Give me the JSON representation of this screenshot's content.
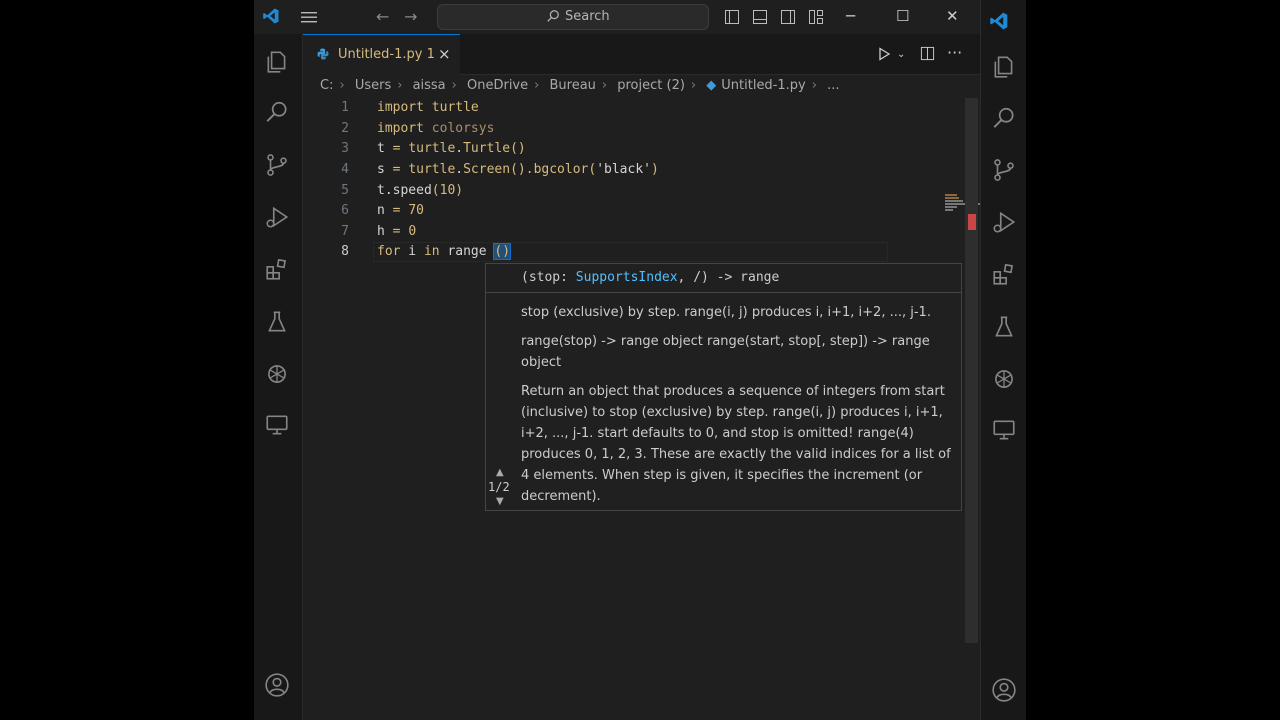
{
  "app": {
    "accent": "#0078d4",
    "logo_icon": "vscode-logo-icon"
  },
  "titlebar": {
    "search_placeholder": "Search"
  },
  "tab": {
    "label": "Untitled-1.py 1",
    "close": "×"
  },
  "breadcrumb": [
    "C:",
    "Users",
    "aissa",
    "OneDrive",
    "Bureau",
    "project (2)",
    "Untitled-1.py",
    "..."
  ],
  "editor": {
    "line_numbers": [
      "1",
      "2",
      "3",
      "4",
      "5",
      "6",
      "7",
      "8"
    ],
    "lines": {
      "l1_kw": "import",
      "l1_mod": "turtle",
      "l2_kw": "import",
      "l2_mod": "colorsys",
      "l3_a": "t",
      "l3_b": " = ",
      "l3_c": "turtle",
      "l3_d": ".",
      "l3_e": "Turtle",
      "l3_f": "()",
      "l4_a": "s",
      "l4_b": " = ",
      "l4_c": "turtle",
      "l4_d": ".",
      "l4_e": "Screen",
      "l4_f": "().",
      "l4_g": "bgcolor",
      "l4_h": "(",
      "l4_i": "'black'",
      "l4_j": ")",
      "l5_a": "t",
      "l5_b": ".",
      "l5_c": "speed",
      "l5_d": "(",
      "l5_e": "10",
      "l5_f": ")",
      "l6_a": "n",
      "l6_b": " = ",
      "l6_c": "70",
      "l7_a": "h",
      "l7_b": " = ",
      "l7_c": "0",
      "l8_a": "for",
      "l8_b": " i ",
      "l8_c": "in",
      "l8_d": " range ",
      "l8_e": "()"
    }
  },
  "hover": {
    "signature_open": "(stop: ",
    "signature_type": "SupportsIndex",
    "signature_close": ", /) -> range",
    "doc_1": "stop (exclusive) by step.  range(i, j) produces i, i+1, i+2, ..., j-1.",
    "doc_2": "range(stop) -> range object range(start, stop[, step]) -> range object",
    "doc_3": "Return an object that produces a sequence of integers from start (inclusive) to stop (exclusive) by step. range(i, j) produces i, i+1, i+2, ..., j-1. start defaults to 0, and stop is omitted! range(4) produces 0, 1, 2, 3. These are exactly the valid indices for a list of 4 elements. When step is given, it specifies the increment (or decrement).",
    "counter": "1/2"
  }
}
